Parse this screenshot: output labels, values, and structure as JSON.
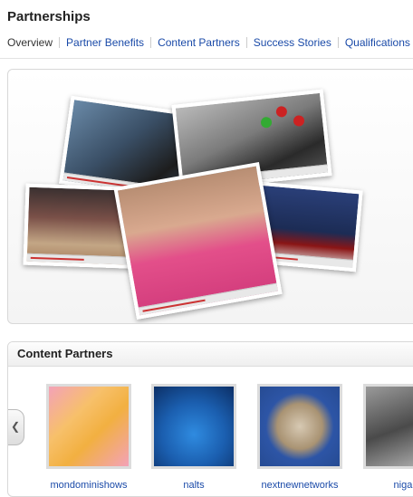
{
  "page": {
    "title": "Partnerships"
  },
  "subnav": {
    "items": [
      "Overview",
      "Partner Benefits",
      "Content Partners",
      "Success Stories",
      "Qualifications"
    ]
  },
  "content_partners": {
    "heading": "Content Partners",
    "prev_icon": "chevron-left-icon",
    "partners": [
      {
        "name": "mondominishows"
      },
      {
        "name": "nalts"
      },
      {
        "name": "nextnewnetworks"
      },
      {
        "name": "nigah"
      }
    ]
  },
  "colors": {
    "link": "#1a4aa8"
  }
}
